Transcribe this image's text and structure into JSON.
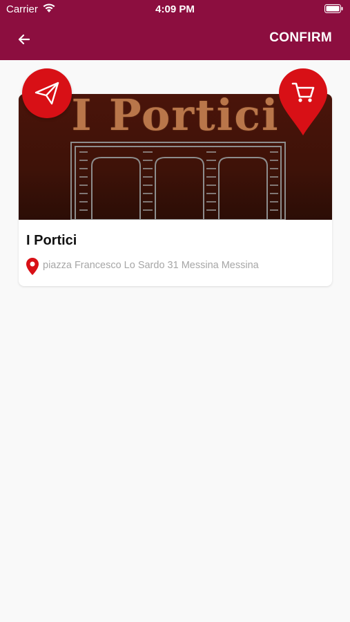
{
  "status_bar": {
    "carrier": "Carrier",
    "time": "4:09 PM"
  },
  "nav": {
    "back_icon": "arrow-left-icon",
    "confirm_label": "CONFIRM"
  },
  "restaurant": {
    "logo_text": "I Portici",
    "name": "I Portici",
    "address": "piazza Francesco Lo Sardo 31 Messina Messina"
  },
  "actions": {
    "send_icon": "paper-plane-icon",
    "cart_icon": "shopping-cart-icon"
  },
  "colors": {
    "header": "#8c0e3f",
    "accent": "#d81016",
    "background": "#f9f9f9",
    "address_text": "#a6a6a6"
  }
}
